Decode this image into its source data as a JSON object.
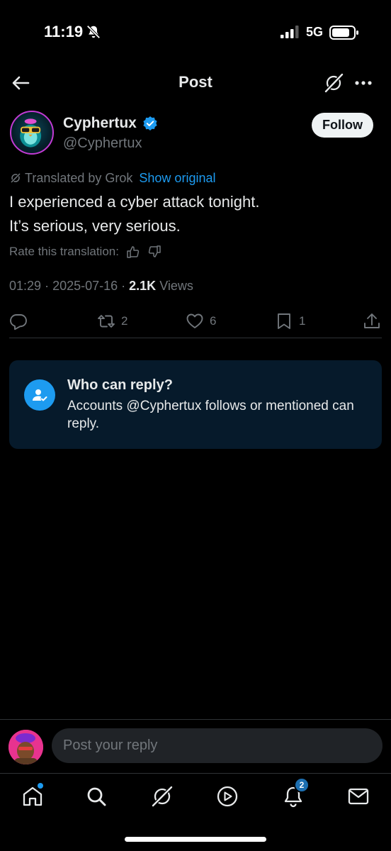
{
  "status_bar": {
    "time": "11:19",
    "network": "5G",
    "icons": [
      "bell-slash-icon",
      "signal-bars-icon",
      "battery-icon"
    ]
  },
  "header": {
    "title": "Post",
    "icons": [
      "back-arrow-icon",
      "grok-icon",
      "more-icon"
    ]
  },
  "post": {
    "author": {
      "display_name": "Cyphertux",
      "handle": "@Cyphertux",
      "verified": true
    },
    "follow_label": "Follow",
    "translation": {
      "label": "Translated by Grok",
      "show_original": "Show original",
      "rate_label": "Rate this translation:"
    },
    "text_lines": [
      "I experienced a cyber attack tonight.",
      "It’s serious, very serious."
    ],
    "meta": {
      "time": "01:29",
      "date": "2025-07-16",
      "views_count": "2.1K",
      "views_label": "Views"
    },
    "actions": {
      "reposts": "2",
      "likes": "6",
      "bookmarks": "1"
    }
  },
  "who_can_reply": {
    "title": "Who can reply?",
    "description": "Accounts @Cyphertux follows or mentioned can reply."
  },
  "composer": {
    "placeholder": "Post your reply"
  },
  "tabbar": {
    "notifications_badge": "2",
    "tabs": [
      "home-icon",
      "search-icon",
      "grok-icon",
      "video-icon",
      "notifications-icon",
      "messages-icon"
    ]
  },
  "colors": {
    "background": "#000000",
    "accent": "#1d9bf0",
    "muted_text": "#71767b",
    "card_background": "#061a2b"
  }
}
